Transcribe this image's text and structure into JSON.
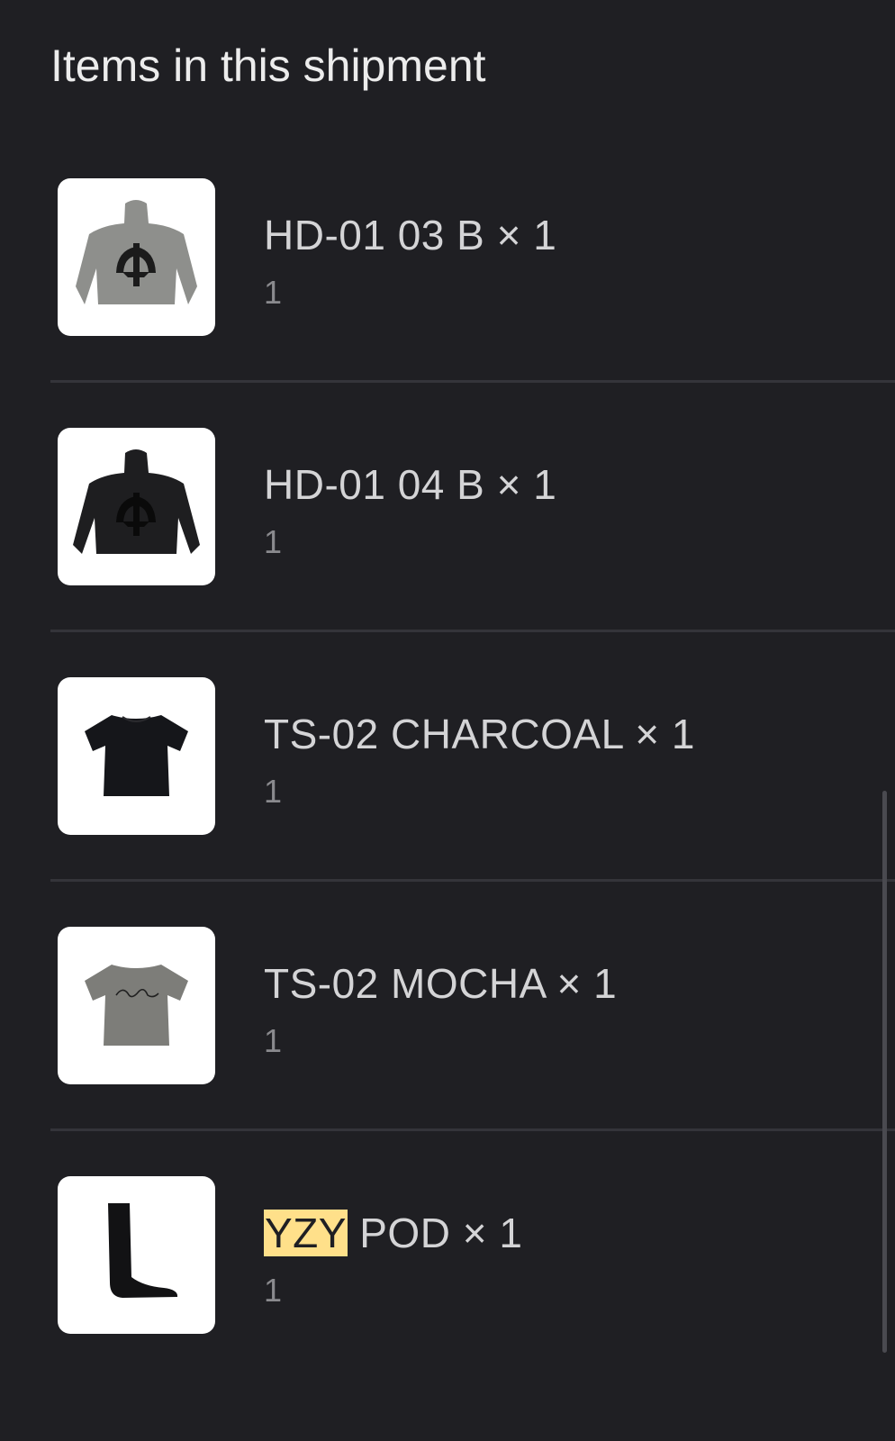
{
  "header": {
    "title": "Items in this shipment"
  },
  "items": [
    {
      "name": "HD-01 03 B × 1",
      "quantity": "1",
      "icon": "grey-hoodie-image"
    },
    {
      "name": "HD-01 04 B × 1",
      "quantity": "1",
      "icon": "black-hoodie-image"
    },
    {
      "name": "TS-02 CHARCOAL × 1",
      "quantity": "1",
      "icon": "black-tshirt-image"
    },
    {
      "name": "TS-02 MOCHA × 1",
      "quantity": "1",
      "icon": "mocha-tshirt-image"
    },
    {
      "name_highlight": "YZY",
      "name_rest": " POD × 1",
      "quantity": "1",
      "icon": "black-sock-image"
    }
  ],
  "colors": {
    "background": "#1f1f23",
    "highlight": "#ffe08a",
    "divider": "#34343a"
  }
}
